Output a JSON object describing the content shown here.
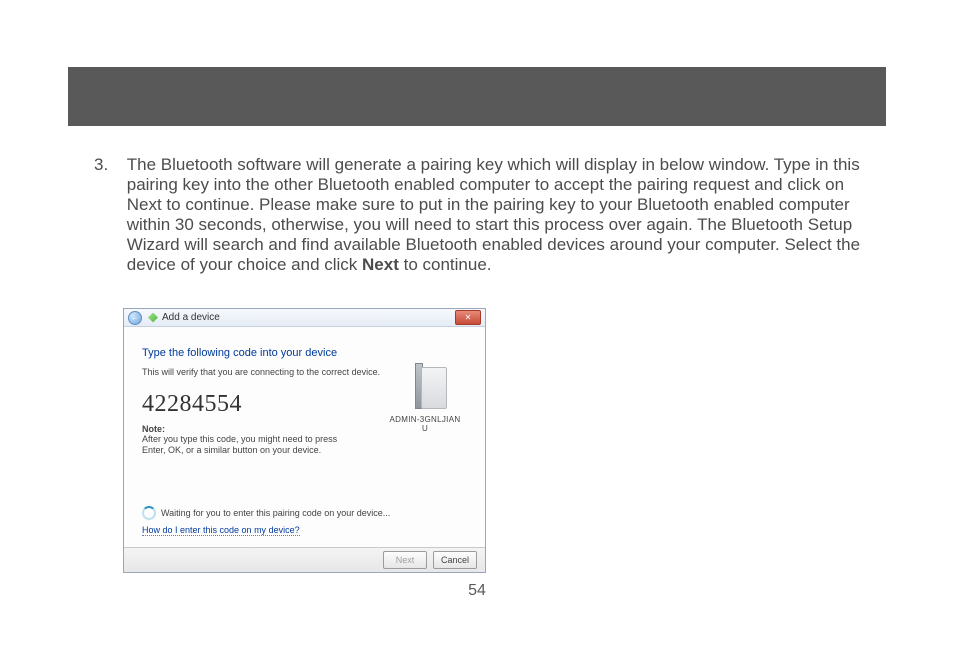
{
  "page_number": "54",
  "step": {
    "number": "3.",
    "text_before_bold": "The Bluetooth software will generate a pairing key which will display in below window.  Type in this pairing key into the other Bluetooth enabled computer to accept the pairing request and click on Next to continue.  Please make sure to put in the pairing key to your Bluetooth enabled computer within 30 seconds, otherwise, you will need to start this process over again.  The Bluetooth Setup Wizard will search and find available Bluetooth enabled devices around your computer.  Select the device of your choice and click ",
    "bold_word": "Next",
    "text_after_bold": " to continue."
  },
  "dialog": {
    "title": "Add a device",
    "instruction": "Type the following code into your device",
    "verify": "This will verify that you are connecting to the correct device.",
    "code": "42284554",
    "note_label": "Note:",
    "note_text": "After you type this code, you might need to press Enter, OK, or a similar button on your device.",
    "device_name": "ADMIN-3GNLJIANU",
    "status": "Waiting for you to enter this pairing code on your device...",
    "help_link": "How do I enter this code on my device?",
    "buttons": {
      "next": "Next",
      "cancel": "Cancel"
    },
    "close_glyph": "✕",
    "back_glyph": "←"
  }
}
